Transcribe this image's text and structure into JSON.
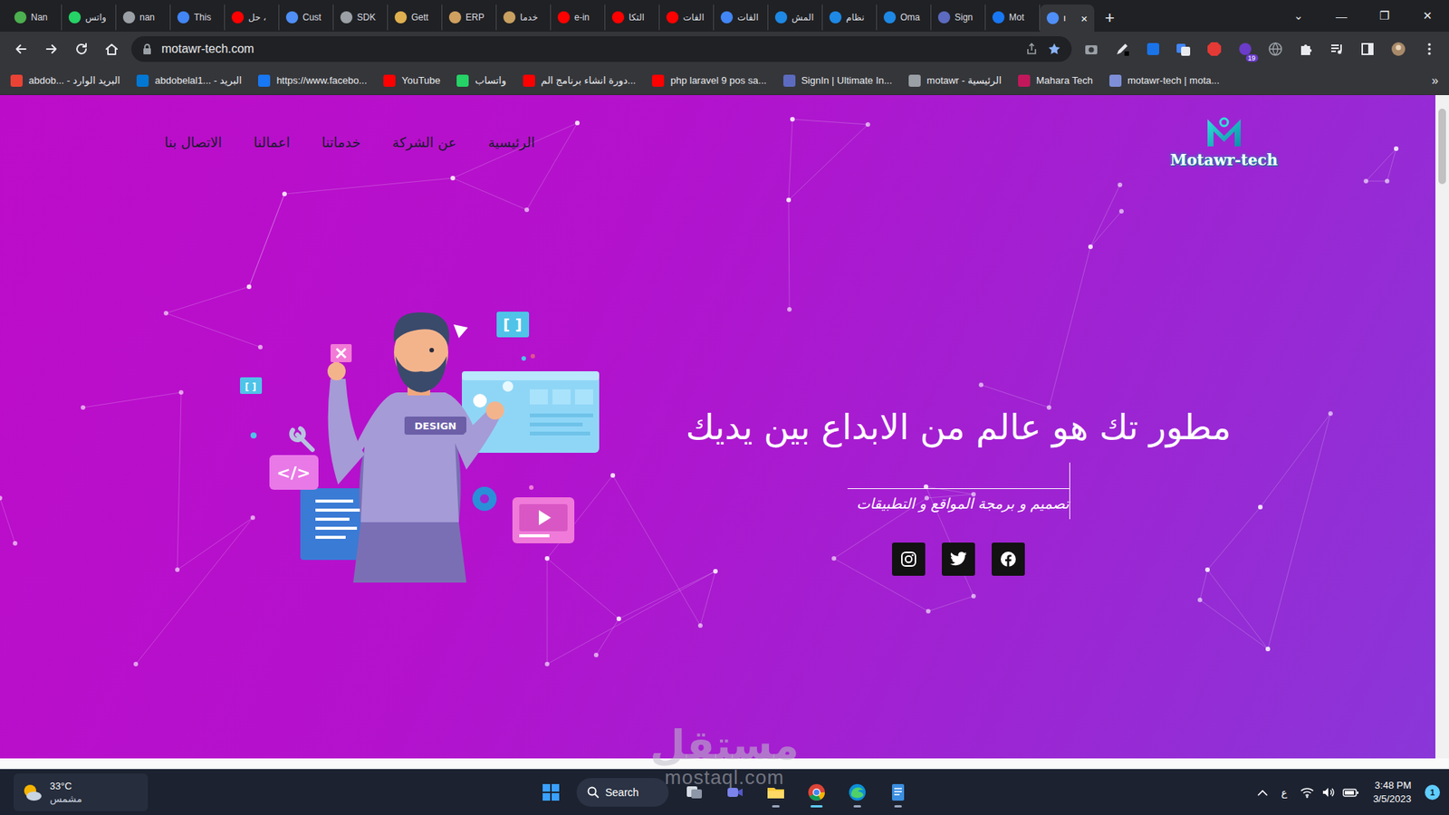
{
  "browser": {
    "tabs": [
      {
        "label": "Nan",
        "selected": false,
        "color": "#4caf50"
      },
      {
        "label": "واتس",
        "selected": false,
        "color": "#25d366"
      },
      {
        "label": "nan",
        "selected": false,
        "color": "#9aa0a6"
      },
      {
        "label": "This",
        "selected": false,
        "color": "#4285f4"
      },
      {
        "label": "حل ،",
        "selected": false,
        "color": "#ff0000"
      },
      {
        "label": "Cust",
        "selected": false,
        "color": "#4f8ff7"
      },
      {
        "label": "SDK",
        "selected": false,
        "color": "#9aa0a6"
      },
      {
        "label": "Gett",
        "selected": false,
        "color": "#e0b050"
      },
      {
        "label": "ERP",
        "selected": false,
        "color": "#d0a060"
      },
      {
        "label": "خدما",
        "selected": false,
        "color": "#c8a060"
      },
      {
        "label": "e-in",
        "selected": false,
        "color": "#ff0000"
      },
      {
        "label": "التكا",
        "selected": false,
        "color": "#ff0000"
      },
      {
        "label": "الفات",
        "selected": false,
        "color": "#ff0000"
      },
      {
        "label": "الفات",
        "selected": false,
        "color": "#4285f4"
      },
      {
        "label": "المش",
        "selected": false,
        "color": "#1e88e5"
      },
      {
        "label": "نظام",
        "selected": false,
        "color": "#1e88e5"
      },
      {
        "label": "Oma",
        "selected": false,
        "color": "#1e88e5"
      },
      {
        "label": "Sign",
        "selected": false,
        "color": "#5c6bc0"
      },
      {
        "label": "Mot",
        "selected": false,
        "color": "#1877f2"
      },
      {
        "label": "ı",
        "selected": true,
        "color": "#4f8ff7"
      }
    ],
    "tab_close": "×",
    "new_tab": "+",
    "window_controls": [
      "⌄",
      "—",
      "❐",
      "✕"
    ],
    "address": "motawr-tech.com",
    "extension_badge": "19",
    "bookmarks": [
      {
        "label": "abdob... - البريد الوارد",
        "color": "#ea4335"
      },
      {
        "label": "abdobelal1... - البريد",
        "color": "#0078d4"
      },
      {
        "label": "https://www.facebo...",
        "color": "#1877f2"
      },
      {
        "label": "YouTube",
        "color": "#ff0000"
      },
      {
        "label": "واتساب",
        "color": "#25d366"
      },
      {
        "label": "دورة انشاء برنامج الم...",
        "color": "#ff0000"
      },
      {
        "label": "php laravel 9 pos sa...",
        "color": "#ff0000"
      },
      {
        "label": "SignIn | Ultimate In...",
        "color": "#5c6bc0"
      },
      {
        "label": "motawr - الرئيسية",
        "color": "#9aa0a6"
      },
      {
        "label": "Mahara Tech",
        "color": "#c2185b"
      },
      {
        "label": "motawr-tech | mota...",
        "color": "#7e8fd8"
      }
    ],
    "bookmarks_more": "»"
  },
  "site": {
    "logo": "Motawr-tech",
    "nav": [
      "الرئيسية",
      "عن الشركة",
      "خدماتنا",
      "اعمالنا",
      "الاتصال بنا"
    ],
    "hero": {
      "title": "مطور تك هو عالم من الابداع بين يديك",
      "subtitle": "تصميم و برمجة المواقع و التطبيقات",
      "illustration": {
        "shirt": "DESIGN",
        "code_badge": "</>",
        "brackets": [
          "[ ]",
          "[ ]"
        ]
      }
    }
  },
  "watermark": {
    "arabic": "مستقل",
    "latin": "mostaql.com"
  },
  "taskbar": {
    "weather": {
      "temp": "33°C",
      "condition": "مشمس"
    },
    "search": "Search",
    "language": "ع",
    "time": "3:48 PM",
    "date": "3/5/2023",
    "notifications": "1"
  }
}
